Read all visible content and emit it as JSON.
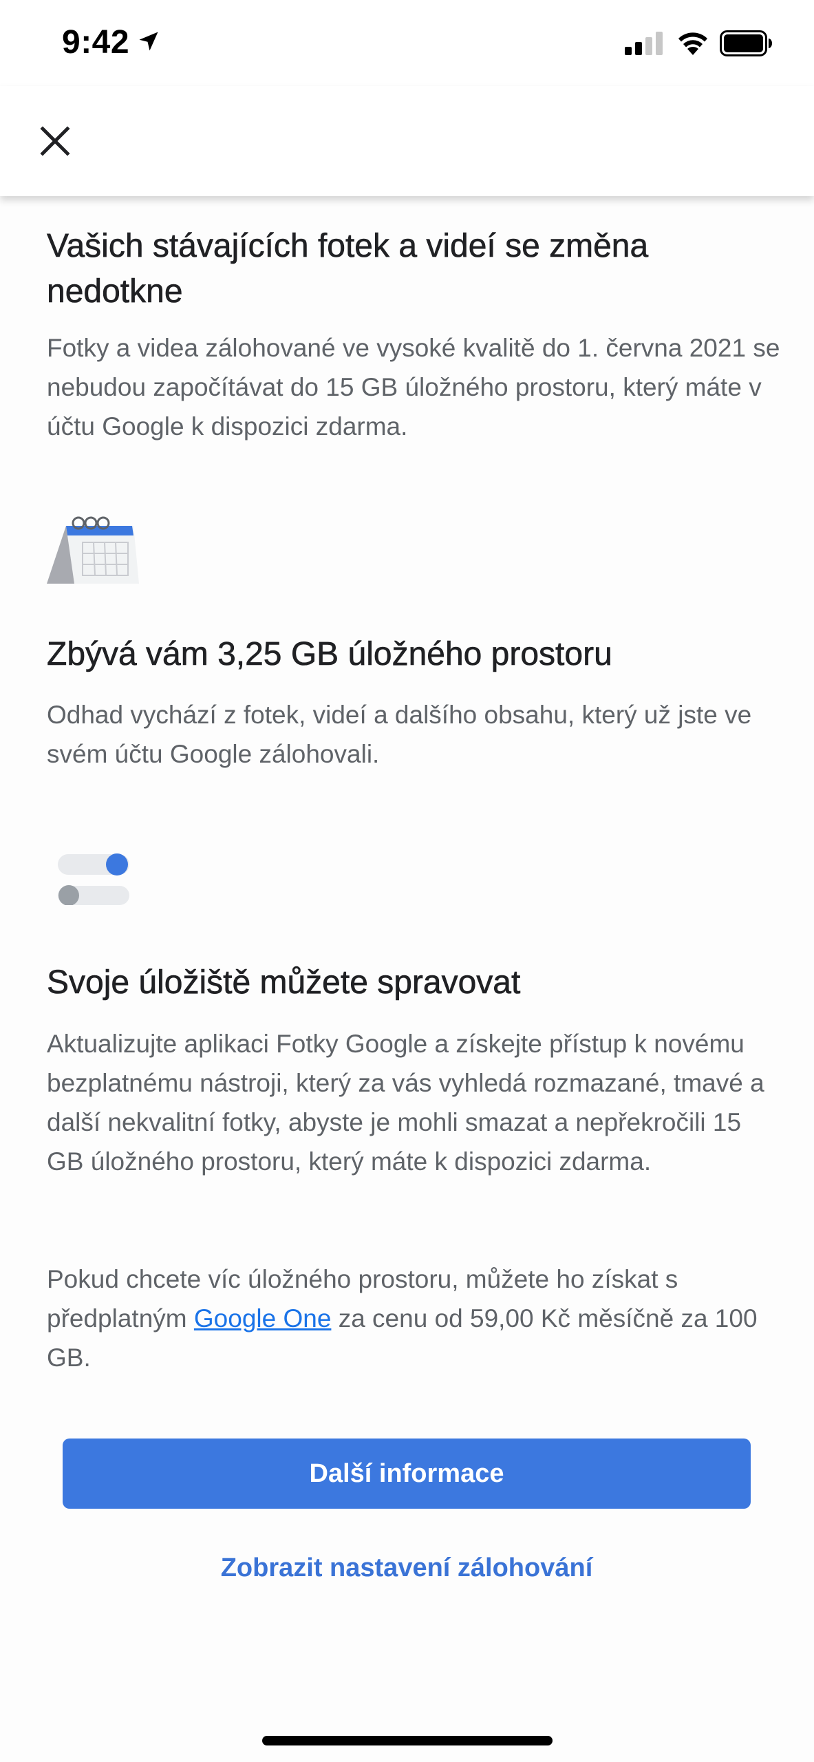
{
  "status_bar": {
    "time": "9:42",
    "location_icon": "location-arrow-icon",
    "signal_icon": "cellular-signal-icon",
    "wifi_icon": "wifi-icon",
    "battery_icon": "battery-icon"
  },
  "header": {
    "close_icon": "close-icon"
  },
  "sections": [
    {
      "title": "Vašich stávajících fotek a videí se změna nedotkne",
      "body": "Fotky a videa zálohované ve vysoké kvalitě do 1. června 2021 se nebudou započítávat do 15 GB úložného prostoru, který máte v účtu Google k dispozici zdarma."
    },
    {
      "icon": "calendar-icon",
      "title": "Zbývá vám 3,25 GB úložného prostoru",
      "body": "Odhad vychází z fotek, videí a dalšího obsahu, který už jste ve svém účtu Google zálohovali."
    },
    {
      "icon": "toggles-icon",
      "title": "Svoje úložiště můžete spravovat",
      "body": "Aktualizujte aplikaci Fotky Google a získejte přístup k novému bezplatnému nástroji, který za vás vyhledá rozmazané, tmavé a další nekvalitní fotky, abyste je mohli smazat a nepřekročili 15 GB úložného prostoru, který máte k dispozici zdarma."
    }
  ],
  "upsell": {
    "text_before": "Pokud chcete víc úložného prostoru, můžete ho získat s předplatným ",
    "link_text": "Google One",
    "text_after": " za cenu od 59,00 Kč měsíčně za 100 GB."
  },
  "buttons": {
    "primary_label": "Další informace",
    "secondary_label": "Zobrazit nastavení zálohování"
  },
  "colors": {
    "accent": "#3c78df",
    "link": "#1a73e8",
    "body_text": "#5f6368",
    "title_text": "#202124"
  }
}
